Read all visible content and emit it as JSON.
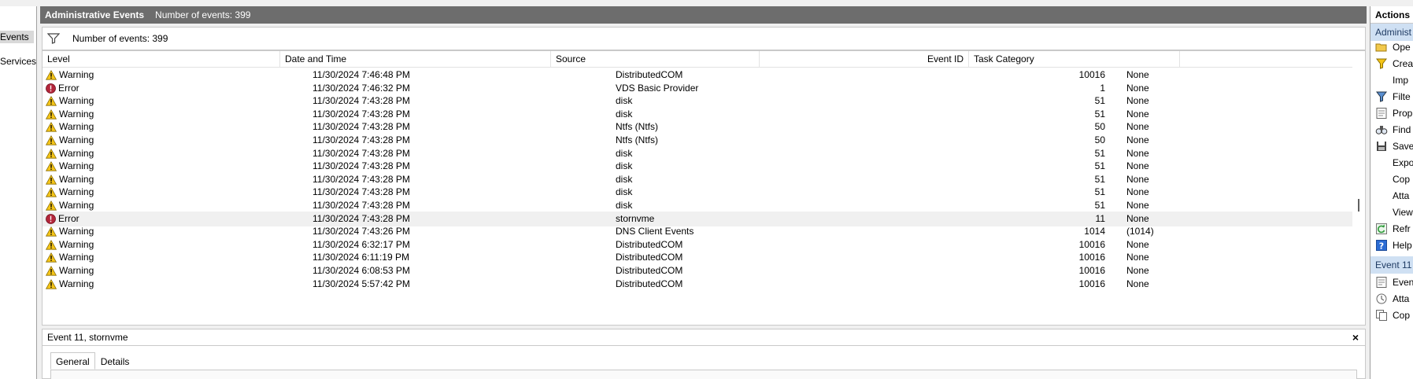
{
  "left_tree": {
    "items": [
      {
        "label": "Events",
        "selected": true
      },
      {
        "label": "Services Lo",
        "selected": false
      }
    ]
  },
  "center": {
    "header_title": "Administrative Events",
    "header_count": "Number of events: 399",
    "filter_count": "Number of events: 399",
    "columns": {
      "level": "Level",
      "date": "Date and Time",
      "source": "Source",
      "event_id": "Event ID",
      "task": "Task Category"
    },
    "rows": [
      {
        "level": "Warning",
        "icon": "warning-icon",
        "date": "11/30/2024 7:46:48 PM",
        "source": "DistributedCOM",
        "event_id": "10016",
        "task": "None"
      },
      {
        "level": "Error",
        "icon": "error-icon",
        "date": "11/30/2024 7:46:32 PM",
        "source": "VDS Basic Provider",
        "event_id": "1",
        "task": "None"
      },
      {
        "level": "Warning",
        "icon": "warning-icon",
        "date": "11/30/2024 7:43:28 PM",
        "source": "disk",
        "event_id": "51",
        "task": "None"
      },
      {
        "level": "Warning",
        "icon": "warning-icon",
        "date": "11/30/2024 7:43:28 PM",
        "source": "disk",
        "event_id": "51",
        "task": "None"
      },
      {
        "level": "Warning",
        "icon": "warning-icon",
        "date": "11/30/2024 7:43:28 PM",
        "source": "Ntfs (Ntfs)",
        "event_id": "50",
        "task": "None"
      },
      {
        "level": "Warning",
        "icon": "warning-icon",
        "date": "11/30/2024 7:43:28 PM",
        "source": "Ntfs (Ntfs)",
        "event_id": "50",
        "task": "None"
      },
      {
        "level": "Warning",
        "icon": "warning-icon",
        "date": "11/30/2024 7:43:28 PM",
        "source": "disk",
        "event_id": "51",
        "task": "None"
      },
      {
        "level": "Warning",
        "icon": "warning-icon",
        "date": "11/30/2024 7:43:28 PM",
        "source": "disk",
        "event_id": "51",
        "task": "None"
      },
      {
        "level": "Warning",
        "icon": "warning-icon",
        "date": "11/30/2024 7:43:28 PM",
        "source": "disk",
        "event_id": "51",
        "task": "None"
      },
      {
        "level": "Warning",
        "icon": "warning-icon",
        "date": "11/30/2024 7:43:28 PM",
        "source": "disk",
        "event_id": "51",
        "task": "None"
      },
      {
        "level": "Warning",
        "icon": "warning-icon",
        "date": "11/30/2024 7:43:28 PM",
        "source": "disk",
        "event_id": "51",
        "task": "None"
      },
      {
        "level": "Error",
        "icon": "error-icon",
        "date": "11/30/2024 7:43:28 PM",
        "source": "stornvme",
        "event_id": "11",
        "task": "None",
        "selected": true
      },
      {
        "level": "Warning",
        "icon": "warning-icon",
        "date": "11/30/2024 7:43:26 PM",
        "source": "DNS Client Events",
        "event_id": "1014",
        "task": "(1014)"
      },
      {
        "level": "Warning",
        "icon": "warning-icon",
        "date": "11/30/2024 6:32:17 PM",
        "source": "DistributedCOM",
        "event_id": "10016",
        "task": "None"
      },
      {
        "level": "Warning",
        "icon": "warning-icon",
        "date": "11/30/2024 6:11:19 PM",
        "source": "DistributedCOM",
        "event_id": "10016",
        "task": "None"
      },
      {
        "level": "Warning",
        "icon": "warning-icon",
        "date": "11/30/2024 6:08:53 PM",
        "source": "DistributedCOM",
        "event_id": "10016",
        "task": "None"
      },
      {
        "level": "Warning",
        "icon": "warning-icon",
        "date": "11/30/2024 5:57:42 PM",
        "source": "DistributedCOM",
        "event_id": "10016",
        "task": "None"
      }
    ],
    "detail": {
      "title": "Event 11, stornvme",
      "close_label": "×",
      "tabs": [
        "General",
        "Details"
      ]
    }
  },
  "actions": {
    "title": "Actions",
    "section1": "Administ",
    "items1": [
      {
        "label": "Ope",
        "icon": "folder-open-icon"
      },
      {
        "label": "Crea",
        "icon": "create-filter-icon"
      },
      {
        "label": "Imp",
        "icon": ""
      },
      {
        "label": "Filte",
        "icon": "filter-icon"
      },
      {
        "label": "Prop",
        "icon": "properties-icon"
      },
      {
        "label": "Find",
        "icon": "find-icon"
      },
      {
        "label": "Save",
        "icon": "save-icon"
      },
      {
        "label": "Expo",
        "icon": ""
      },
      {
        "label": "Cop",
        "icon": ""
      },
      {
        "label": "Atta",
        "icon": ""
      },
      {
        "label": "View",
        "icon": ""
      },
      {
        "label": "Refr",
        "icon": "refresh-icon"
      },
      {
        "label": "Help",
        "icon": "help-icon"
      }
    ],
    "section2": "Event 11",
    "items2": [
      {
        "label": "Even",
        "icon": "event-properties-icon"
      },
      {
        "label": "Atta",
        "icon": "attach-task-icon"
      },
      {
        "label": "Cop",
        "icon": "copy-icon"
      }
    ]
  },
  "colors": {
    "header_bg": "#6d6d6d",
    "section_bg": "#cfe0f3",
    "warning": "#f5c518",
    "error": "#b3263a"
  }
}
